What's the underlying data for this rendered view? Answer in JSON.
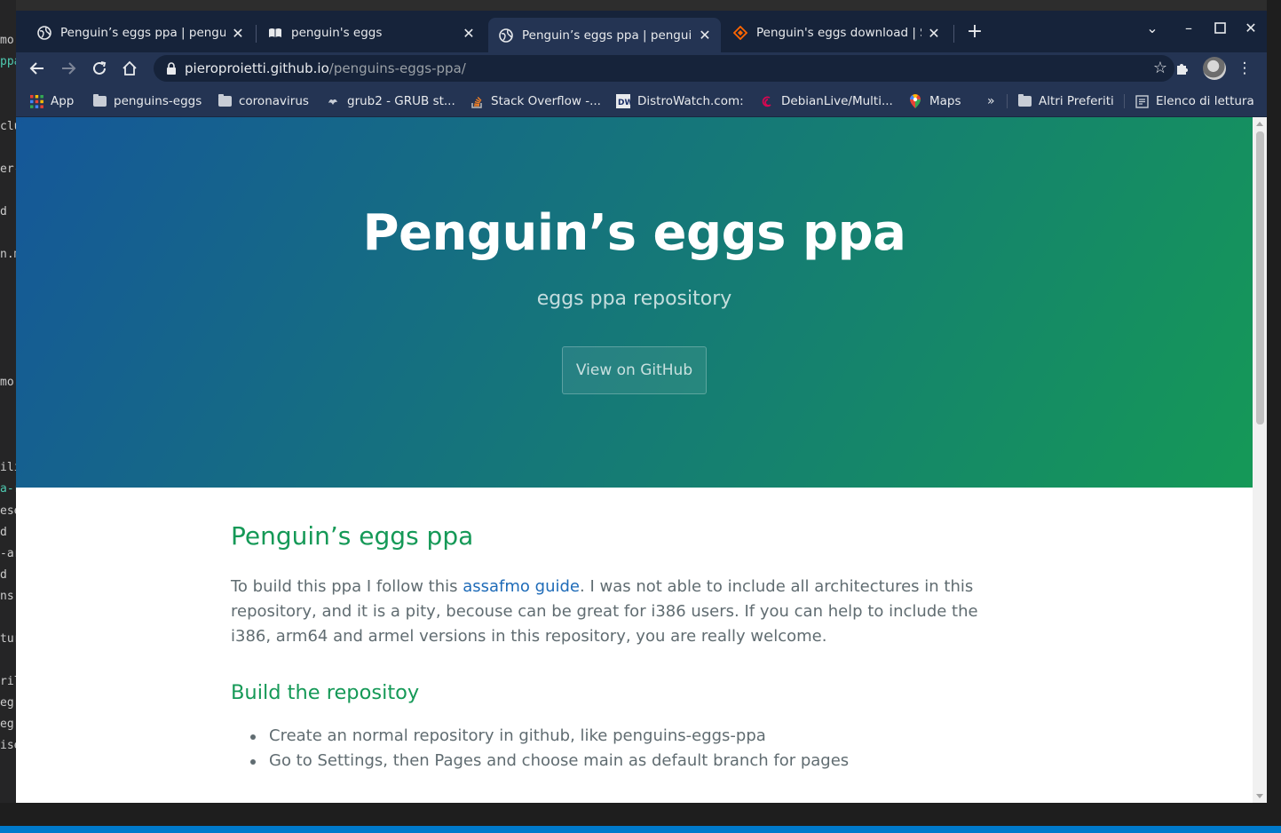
{
  "browser": {
    "tabs": [
      {
        "title": "Penguin’s eggs ppa | penguins-eggs-ppa",
        "active": false
      },
      {
        "title": "penguin's eggs",
        "active": false
      },
      {
        "title": "Penguin’s eggs ppa | penguins-eggs-ppa",
        "active": true
      },
      {
        "title": "Penguin's eggs download | SourceForge.net",
        "active": false
      }
    ],
    "url_host": "pieroproietti.github.io",
    "url_path": "/penguins-eggs-ppa/",
    "bookmarks": [
      "App",
      "penguins-eggs",
      "coronavirus",
      "grub2 - GRUB st...",
      "Stack Overflow -...",
      "DistroWatch.com:",
      "DebianLive/Multi...",
      "Maps"
    ],
    "bookmarks_overflow": "»",
    "other_bookmarks": "Altri Preferiti",
    "reading_list": "Elenco di lettura",
    "colors": {
      "tabstrip": "#16233a",
      "toolbar": "#243453"
    }
  },
  "page": {
    "hero_title": "Penguin’s eggs ppa",
    "hero_tagline": "eggs ppa repository",
    "hero_button": "View on GitHub",
    "h2": "Penguin’s eggs ppa",
    "intro_before_link": "To build this ppa I follow this ",
    "intro_link": "assafmo guide",
    "intro_after_link": ". I was not able to include all architectures in this repository, and it is a pity, becouse can be great for i386 users. If you can help to include the i386, arm64 and armel versions in this repository, you are really welcome.",
    "h3": "Build the repositoy",
    "steps": [
      "Create an normal repository in github, like penguins-eggs-ppa",
      "Go to Settings, then Pages and choose main as default branch for pages"
    ],
    "colors": {
      "gradient_start": "#155799",
      "gradient_end": "#159957",
      "heading": "#159957",
      "link": "#1e6bb8",
      "text": "#606c71"
    }
  },
  "background_editor": {
    "fragments": [
      "mo",
      "ppa",
      "clu",
      "er-c",
      "d",
      "n.m",
      "mo",
      "ilita",
      "a-r",
      "ese",
      "d",
      "-ar",
      "d",
      "ns.",
      "tur",
      "rilla",
      "eg",
      "eg",
      "ise"
    ]
  }
}
